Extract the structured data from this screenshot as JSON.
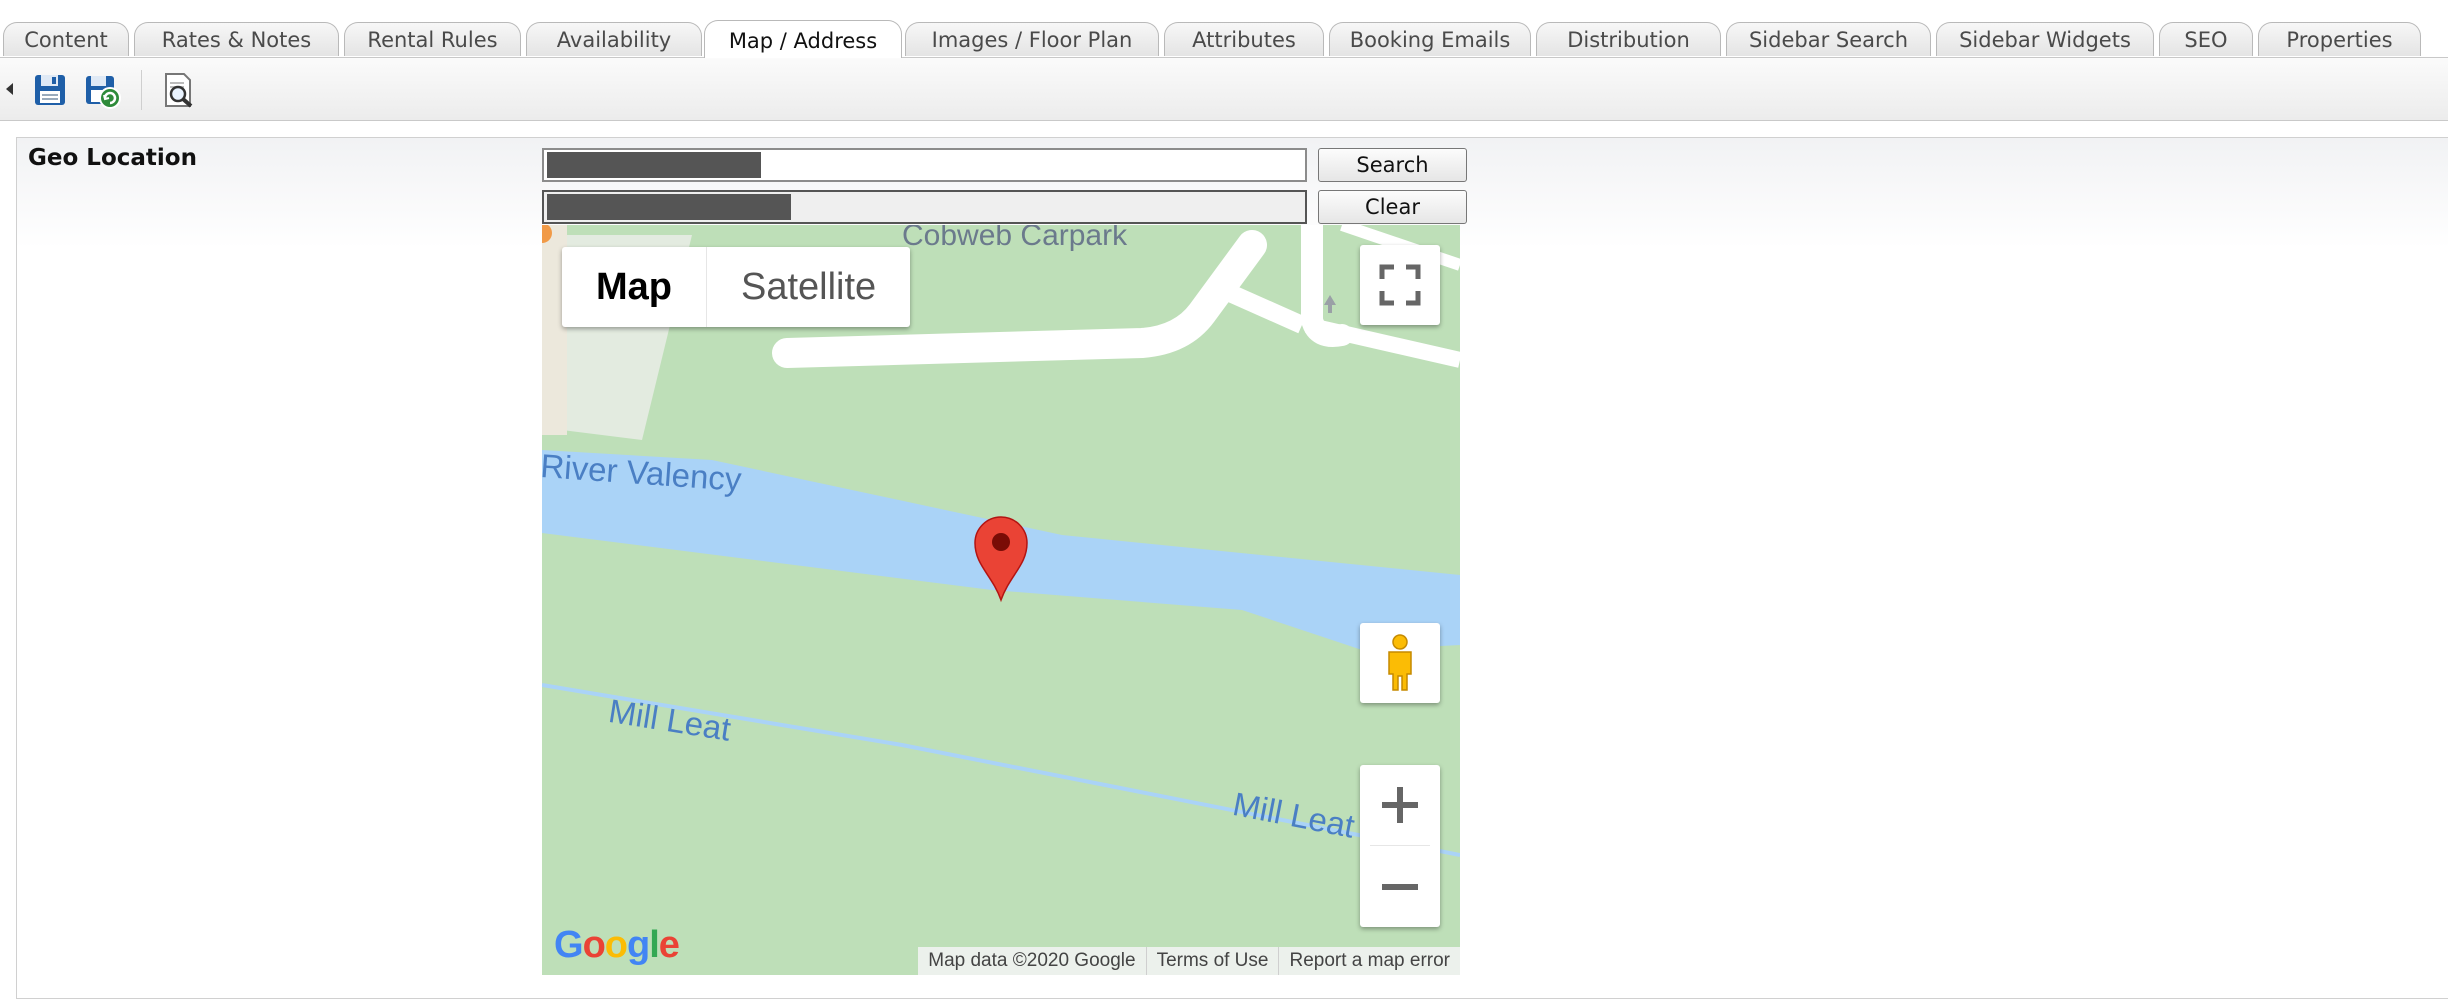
{
  "tabs": [
    {
      "label": "Content"
    },
    {
      "label": "Rates & Notes"
    },
    {
      "label": "Rental Rules"
    },
    {
      "label": "Availability"
    },
    {
      "label": "Map / Address"
    },
    {
      "label": "Images / Floor Plan"
    },
    {
      "label": "Attributes"
    },
    {
      "label": "Booking Emails"
    },
    {
      "label": "Distribution"
    },
    {
      "label": "Sidebar Search"
    },
    {
      "label": "Sidebar Widgets"
    },
    {
      "label": "SEO"
    },
    {
      "label": "Properties"
    }
  ],
  "active_tab": "Map / Address",
  "toolbar": {
    "icons": [
      "collapse-arrow-icon",
      "save-icon",
      "save-all-icon",
      "preview-icon"
    ]
  },
  "geo": {
    "label": "Geo Location",
    "search_button": "Search",
    "clear_button": "Clear"
  },
  "map": {
    "type_map": "Map",
    "type_satellite": "Satellite",
    "labels": {
      "carpark": "Cobweb Carpark",
      "river": "River Valency",
      "mill_leat_1": "Mill Leat",
      "mill_leat_2": "Mill Leat"
    },
    "attribution": {
      "data": "Map data ©2020 Google",
      "terms": "Terms of Use",
      "report": "Report a map error"
    },
    "logo": "Google",
    "colors": {
      "land": "#bedfb8",
      "water": "#aad3f7",
      "road": "#ffffff",
      "marker": "#ea4335",
      "water_label": "#4a7fc4"
    }
  }
}
